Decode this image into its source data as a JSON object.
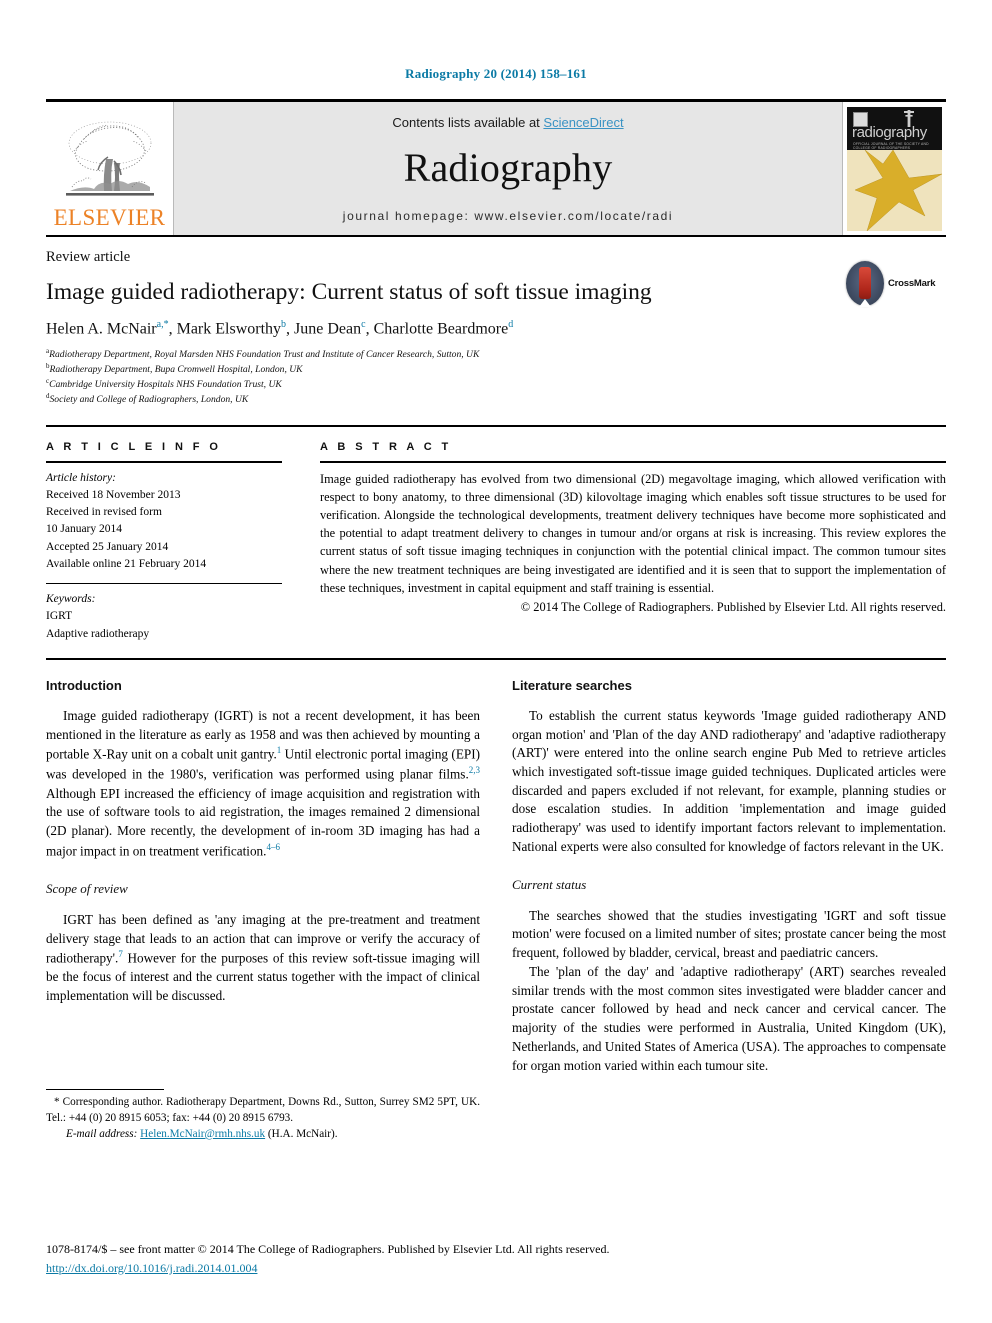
{
  "running_head": "Radiography 20 (2014) 158–161",
  "masthead": {
    "elsevier_wordmark": "ELSEVIER",
    "contents_prefix": "Contents lists available at ",
    "contents_link": "ScienceDirect",
    "journal_title": "Radiography",
    "homepage": "journal homepage: www.elsevier.com/locate/radi",
    "cover": {
      "title": "radiography",
      "subtitle": "OFFICIAL JOURNAL OF THE SOCIETY AND COLLEGE OF RADIOGRAPHERS"
    },
    "colors": {
      "band_background": "#e6e6e6",
      "link_blue": "#3a93c4",
      "elsevier_orange": "#ec8226",
      "cover_yellow": "#efe3bd"
    }
  },
  "article": {
    "kicker": "Review article",
    "title": "Image guided radiotherapy: Current status of soft tissue imaging",
    "authors": "Helen A. McNair a,*, Mark Elsworthy b, June Dean c, Charlotte Beardmore d",
    "author_list": [
      {
        "name": "Helen A. McNair",
        "marks": "a,*"
      },
      {
        "name": "Mark Elsworthy",
        "marks": "b"
      },
      {
        "name": "June Dean",
        "marks": "c"
      },
      {
        "name": "Charlotte Beardmore",
        "marks": "d"
      }
    ],
    "affiliations": [
      {
        "mark": "a",
        "text": "Radiotherapy Department, Royal Marsden NHS Foundation Trust and Institute of Cancer Research, Sutton, UK"
      },
      {
        "mark": "b",
        "text": "Radiotherapy Department, Bupa Cromwell Hospital, London, UK"
      },
      {
        "mark": "c",
        "text": "Cambridge University Hospitals NHS Foundation Trust, UK"
      },
      {
        "mark": "d",
        "text": "Society and College of Radiographers, London, UK"
      }
    ],
    "crossmark_label": "CrossMark"
  },
  "article_info": {
    "heading": "A R T I C L E   I N F O",
    "history_label": "Article history:",
    "history": [
      "Received 18 November 2013",
      "Received in revised form",
      "10 January 2014",
      "Accepted 25 January 2014",
      "Available online 21 February 2014"
    ],
    "keywords_label": "Keywords:",
    "keywords": [
      "IGRT",
      "Adaptive radiotherapy"
    ]
  },
  "abstract": {
    "heading": "A B S T R A C T",
    "body": "Image guided radiotherapy has evolved from two dimensional (2D) megavoltage imaging, which allowed verification with respect to bony anatomy, to three dimensional (3D) kilovoltage imaging which enables soft tissue structures to be used for verification. Alongside the technological developments, treatment delivery techniques have become more sophisticated and the potential to adapt treatment delivery to changes in tumour and/or organs at risk is increasing. This review explores the current status of soft tissue imaging techniques in conjunction with the potential clinical impact. The common tumour sites where the new treatment techniques are being investigated are identified and it is seen that to support the implementation of these techniques, investment in capital equipment and staff training is essential.",
    "copyright": "© 2014 The College of Radiographers. Published by Elsevier Ltd. All rights reserved."
  },
  "body": {
    "left_column": {
      "section1_heading": "Introduction",
      "section1_p1_a": "Image guided radiotherapy (IGRT) is not a recent development, it has been mentioned in the literature as early as 1958 and was then achieved by mounting a portable X-Ray unit on a cobalt unit gantry.",
      "section1_p1_ref1": "1",
      "section1_p1_b": " Until electronic portal imaging (EPI) was developed in the 1980's, verification was performed using planar films.",
      "section1_p1_ref2": "2,3",
      "section1_p1_c": " Although EPI increased the efficiency of image acquisition and registration with the use of software tools to aid registration, the images remained 2 dimensional (2D planar). More recently, the development of in-room 3D imaging has had a major impact in on treatment verification.",
      "section1_p1_ref3": "4–6",
      "section2_heading": "Scope of review",
      "section2_p1_a": "IGRT has been defined as 'any imaging at the pre-treatment and treatment delivery stage that leads to an action that can improve or verify the accuracy of radiotherapy'.",
      "section2_p1_ref1": "7",
      "section2_p1_b": " However for the purposes of this review soft-tissue imaging will be the focus of interest and the current status together with the impact of clinical implementation will be discussed."
    },
    "right_column": {
      "section1_heading": "Literature searches",
      "section1_p1": "To establish the current status keywords 'Image guided radiotherapy AND organ motion' and 'Plan of the day AND radiotherapy' and 'adaptive radiotherapy (ART)' were entered into the online search engine Pub Med to retrieve articles which investigated soft-tissue image guided techniques. Duplicated articles were discarded and papers excluded if not relevant, for example, planning studies or dose escalation studies. In addition 'implementation and image guided radiotherapy' was used to identify important factors relevant to implementation. National experts were also consulted for knowledge of factors relevant in the UK.",
      "section2_heading": "Current status",
      "section2_p1": "The searches showed that the studies investigating 'IGRT and soft tissue motion' were focused on a limited number of sites; prostate cancer being the most frequent, followed by bladder, cervical, breast and paediatric cancers.",
      "section2_p2": "The 'plan of the day' and 'adaptive radiotherapy' (ART) searches revealed similar trends with the most common sites investigated were bladder cancer and prostate cancer followed by head and neck cancer and cervical cancer. The majority of the studies were performed in Australia, United Kingdom (UK), Netherlands, and United States of America (USA). The approaches to compensate for organ motion varied within each tumour site."
    }
  },
  "footnote": {
    "corresponding": "* Corresponding author. Radiotherapy Department, Downs Rd., Sutton, Surrey SM2 5PT, UK. Tel.: +44 (0) 20 8915 6053; fax: +44 (0) 20 8915 6793.",
    "email_label": "E-mail address:",
    "email": "Helen.McNair@rmh.nhs.uk",
    "email_attrib": "(H.A. McNair)."
  },
  "page_footer": {
    "front_matter": "1078-8174/$ – see front matter © 2014 The College of Radiographers. Published by Elsevier Ltd. All rights reserved.",
    "doi": "http://dx.doi.org/10.1016/j.radi.2014.01.004"
  }
}
